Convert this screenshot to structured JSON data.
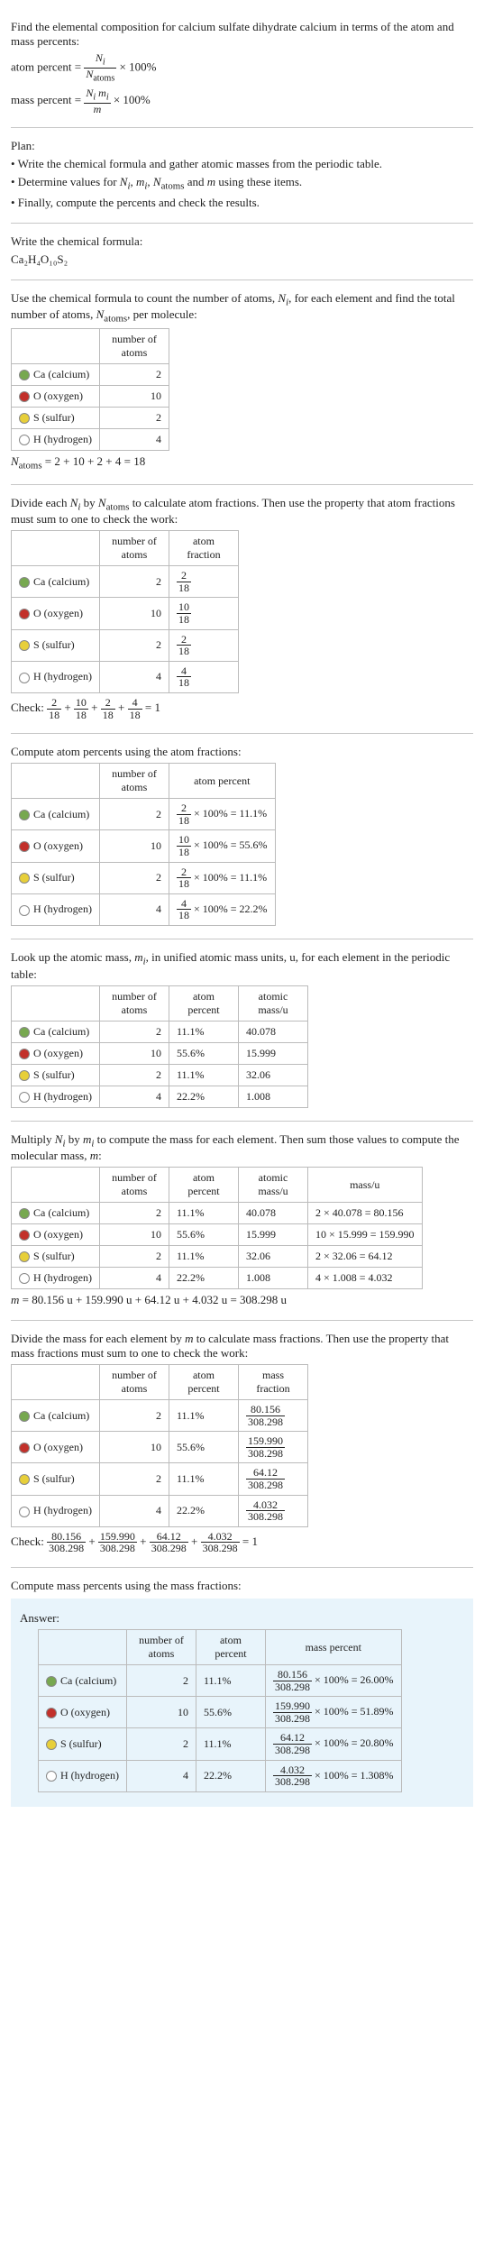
{
  "intro": {
    "line1": "Find the elemental composition for calcium sulfate dihydrate calcium in terms of the atom and mass percents:",
    "eq_atom_lhs": "atom percent =",
    "eq_atom_frac_num": "N_i",
    "eq_atom_frac_den": "N_atoms",
    "times100": "× 100%",
    "eq_mass_lhs": "mass percent =",
    "eq_mass_frac_num": "N_i m_i",
    "eq_mass_frac_den": "m"
  },
  "plan": {
    "title": "Plan:",
    "b1": "• Write the chemical formula and gather atomic masses from the periodic table.",
    "b2": "• Determine values for N_i, m_i, N_atoms and m using these items.",
    "b3": "• Finally, compute the percents and check the results."
  },
  "formula_section": {
    "line": "Write the chemical formula:",
    "formula_disp": "Ca₂H₄O₁₀S₂"
  },
  "count_section": {
    "line": "Use the chemical formula to count the number of atoms, N_i, for each element and find the total number of atoms, N_atoms, per molecule:",
    "col_num_atoms": "number of atoms",
    "rows": {
      "ca": {
        "label": "Ca (calcium)",
        "n": "2"
      },
      "o": {
        "label": "O (oxygen)",
        "n": "10"
      },
      "s": {
        "label": "S (sulfur)",
        "n": "2"
      },
      "h": {
        "label": "H (hydrogen)",
        "n": "4"
      }
    },
    "sum_line_lhs": "N_atoms = 2 + 10 + 2 + 4 = ",
    "sum_line_val": "18"
  },
  "atomfrac_section": {
    "line": "Divide each N_i by N_atoms to calculate atom fractions. Then use the property that atom fractions must sum to one to check the work:",
    "col_num_atoms": "number of atoms",
    "col_atom_frac": "atom fraction",
    "rows": {
      "ca": {
        "label": "Ca (calcium)",
        "n": "2",
        "frac_num": "2",
        "frac_den": "18"
      },
      "o": {
        "label": "O (oxygen)",
        "n": "10",
        "frac_num": "10",
        "frac_den": "18"
      },
      "s": {
        "label": "S (sulfur)",
        "n": "2",
        "frac_num": "2",
        "frac_den": "18"
      },
      "h": {
        "label": "H (hydrogen)",
        "n": "4",
        "frac_num": "4",
        "frac_den": "18"
      }
    },
    "check_label": "Check: ",
    "check_expr": " = 1"
  },
  "atompct_section": {
    "line": "Compute atom percents using the atom fractions:",
    "col_num_atoms": "number of atoms",
    "col_atom_pct": "atom percent",
    "rows": {
      "ca": {
        "label": "Ca (calcium)",
        "n": "2",
        "num": "2",
        "den": "18",
        "pct": "11.1%"
      },
      "o": {
        "label": "O (oxygen)",
        "n": "10",
        "num": "10",
        "den": "18",
        "pct": "55.6%"
      },
      "s": {
        "label": "S (sulfur)",
        "n": "2",
        "num": "2",
        "den": "18",
        "pct": "11.1%"
      },
      "h": {
        "label": "H (hydrogen)",
        "n": "4",
        "num": "4",
        "den": "18",
        "pct": "22.2%"
      }
    }
  },
  "atomicmass_section": {
    "line": "Look up the atomic mass, m_i, in unified atomic mass units, u, for each element in the periodic table:",
    "col_num_atoms": "number of atoms",
    "col_atom_pct": "atom percent",
    "col_amu": "atomic mass/u",
    "rows": {
      "ca": {
        "label": "Ca (calcium)",
        "n": "2",
        "pct": "11.1%",
        "m": "40.078"
      },
      "o": {
        "label": "O (oxygen)",
        "n": "10",
        "pct": "55.6%",
        "m": "15.999"
      },
      "s": {
        "label": "S (sulfur)",
        "n": "2",
        "pct": "11.1%",
        "m": "32.06"
      },
      "h": {
        "label": "H (hydrogen)",
        "n": "4",
        "pct": "22.2%",
        "m": "1.008"
      }
    }
  },
  "molmass_section": {
    "line": "Multiply N_i by m_i to compute the mass for each element. Then sum those values to compute the molecular mass, m:",
    "col_num_atoms": "number of atoms",
    "col_atom_pct": "atom percent",
    "col_amu": "atomic mass/u",
    "col_mass": "mass/u",
    "rows": {
      "ca": {
        "label": "Ca (calcium)",
        "n": "2",
        "pct": "11.1%",
        "m": "40.078",
        "calc": "2 × 40.078 = 80.156"
      },
      "o": {
        "label": "O (oxygen)",
        "n": "10",
        "pct": "55.6%",
        "m": "15.999",
        "calc": "10 × 15.999 = 159.990"
      },
      "s": {
        "label": "S (sulfur)",
        "n": "2",
        "pct": "11.1%",
        "m": "32.06",
        "calc": "2 × 32.06 = 64.12"
      },
      "h": {
        "label": "H (hydrogen)",
        "n": "4",
        "pct": "22.2%",
        "m": "1.008",
        "calc": "4 × 1.008 = 4.032"
      }
    },
    "sum_line": "m = 80.156 u + 159.990 u + 64.12 u + 4.032 u = 308.298 u"
  },
  "massfrac_section": {
    "line": "Divide the mass for each element by m to calculate mass fractions. Then use the property that mass fractions must sum to one to check the work:",
    "col_num_atoms": "number of atoms",
    "col_atom_pct": "atom percent",
    "col_mass_frac": "mass fraction",
    "rows": {
      "ca": {
        "label": "Ca (calcium)",
        "n": "2",
        "pct": "11.1%",
        "num": "80.156",
        "den": "308.298"
      },
      "o": {
        "label": "O (oxygen)",
        "n": "10",
        "pct": "55.6%",
        "num": "159.990",
        "den": "308.298"
      },
      "s": {
        "label": "S (sulfur)",
        "n": "2",
        "pct": "11.1%",
        "num": "64.12",
        "den": "308.298"
      },
      "h": {
        "label": "H (hydrogen)",
        "n": "4",
        "pct": "22.2%",
        "num": "4.032",
        "den": "308.298"
      }
    },
    "check_label": "Check: ",
    "check_expr": " = 1"
  },
  "answer_section": {
    "line": "Compute mass percents using the mass fractions:",
    "answer_label": "Answer:",
    "col_num_atoms": "number of atoms",
    "col_atom_pct": "atom percent",
    "col_mass_pct": "mass percent",
    "rows": {
      "ca": {
        "label": "Ca (calcium)",
        "n": "2",
        "pct": "11.1%",
        "num": "80.156",
        "den": "308.298",
        "mp": "26.00%"
      },
      "o": {
        "label": "O (oxygen)",
        "n": "10",
        "pct": "55.6%",
        "num": "159.990",
        "den": "308.298",
        "mp": "51.89%"
      },
      "s": {
        "label": "S (sulfur)",
        "n": "2",
        "pct": "11.1%",
        "num": "64.12",
        "den": "308.298",
        "mp": "20.80%"
      },
      "h": {
        "label": "H (hydrogen)",
        "n": "4",
        "pct": "22.2%",
        "num": "4.032",
        "den": "308.298",
        "mp": "1.308%"
      }
    }
  },
  "colors": {
    "ca": "#77a850",
    "o": "#c2302a",
    "s": "#e7cf3a",
    "h": "#ffffff"
  }
}
